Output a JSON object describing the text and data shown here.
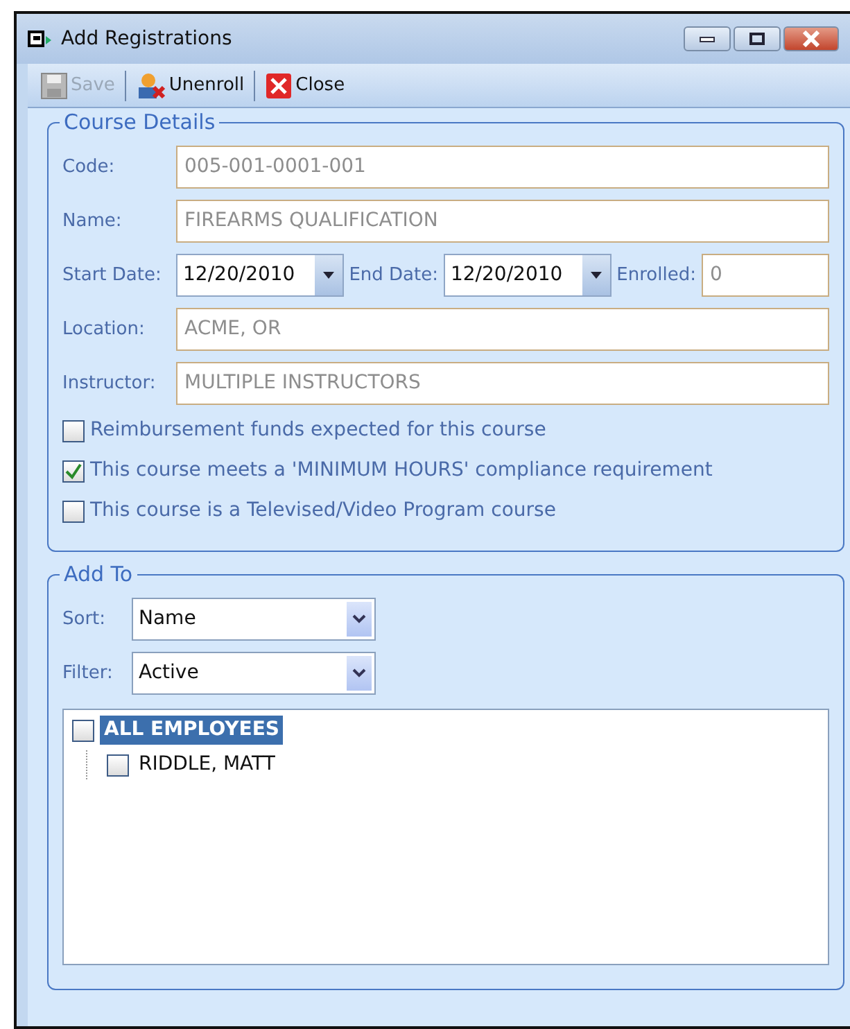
{
  "window": {
    "title": "Add Registrations"
  },
  "toolbar": [
    {
      "label": "Save",
      "kind": "save",
      "disabled": true
    },
    {
      "label": "Unenroll",
      "kind": "unenroll",
      "disabled": false
    },
    {
      "label": "Close",
      "kind": "close",
      "disabled": false
    }
  ],
  "course_details": {
    "title": "Course Details",
    "rows": [
      {
        "fields": [
          {
            "label": "Code:",
            "value": "005-001-0001-001",
            "kind": "text",
            "disabled": true
          }
        ]
      },
      {
        "fields": [
          {
            "label": "Name:",
            "value": "FIREARMS QUALIFICATION",
            "kind": "text",
            "disabled": true
          }
        ]
      },
      {
        "fields": [
          {
            "label": "Start Date:",
            "value": "12/20/2010",
            "kind": "date",
            "disabled": false
          },
          {
            "label": "End Date:",
            "value": "12/20/2010",
            "kind": "date",
            "disabled": false
          },
          {
            "label": "Enrolled:",
            "value": "0",
            "kind": "text",
            "disabled": true
          }
        ]
      },
      {
        "fields": [
          {
            "label": "Location:",
            "value": "ACME, OR",
            "kind": "text",
            "disabled": true
          }
        ]
      },
      {
        "fields": [
          {
            "label": "Instructor:",
            "value": "MULTIPLE INSTRUCTORS",
            "kind": "text",
            "disabled": true
          }
        ]
      }
    ],
    "checkboxes": [
      {
        "label": "Reimbursement funds expected for this course",
        "checked": false
      },
      {
        "label": "This course meets a 'MINIMUM HOURS' compliance requirement",
        "checked": true
      },
      {
        "label": "This course is a Televised/Video Program course",
        "checked": false
      }
    ]
  },
  "add_to": {
    "title": "Add To",
    "selects": [
      {
        "label": "Sort:",
        "value": "Name"
      },
      {
        "label": "Filter:",
        "value": "Active"
      }
    ],
    "tree": [
      {
        "label": "ALL EMPLOYEES",
        "checked": false,
        "selected": true,
        "children": [
          {
            "label": "RIDDLE, MATT",
            "checked": false,
            "selected": false
          }
        ]
      }
    ]
  }
}
